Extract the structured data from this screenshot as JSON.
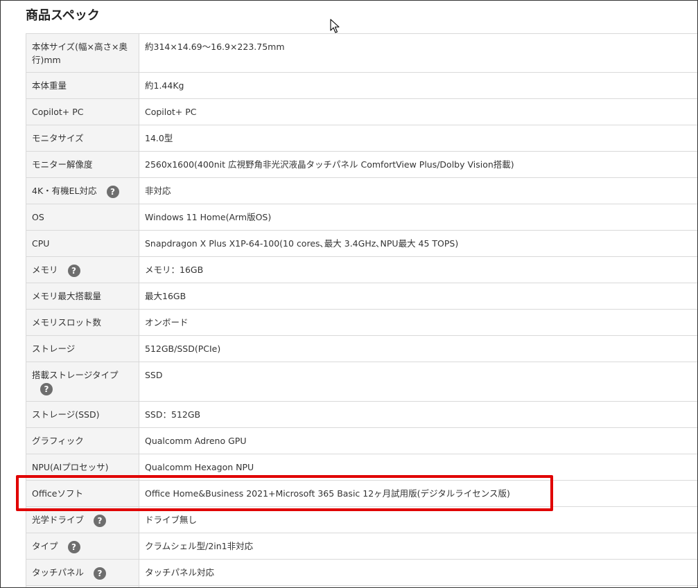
{
  "page": {
    "title": "商品スペック",
    "help_glyph": "?"
  },
  "colors": {
    "highlight": "#e00000",
    "label_bg": "#f4f4f4",
    "border": "#d9d9d9",
    "help_icon": "#6e6e6e"
  },
  "specs": [
    {
      "label": "本体サイズ(幅×高さ×奥行)mm",
      "value": "約314×14.69～16.9×223.75mm"
    },
    {
      "label": "本体重量",
      "value": "約1.44Kg"
    },
    {
      "label": "Copilot+ PC",
      "value": "Copilot+ PC"
    },
    {
      "label": "モニタサイズ",
      "value": "14.0型"
    },
    {
      "label": "モニター解像度",
      "value": "2560x1600(400nit 広視野角非光沢液晶タッチパネル ComfortView Plus/Dolby Vision搭載)"
    },
    {
      "label": "4K・有機EL対応",
      "value": "非対応"
    },
    {
      "label": "OS",
      "value": "Windows 11 Home(Arm版OS)"
    },
    {
      "label": "CPU",
      "value": "Snapdragon X Plus X1P-64-100(10 cores､最大 3.4GHz､NPU最大 45 TOPS)"
    },
    {
      "label": "メモリ",
      "value": "メモリ：16GB"
    },
    {
      "label": "メモリ最大搭載量",
      "value": "最大16GB"
    },
    {
      "label": "メモリスロット数",
      "value": "オンボード"
    },
    {
      "label": "ストレージ",
      "value": "512GB/SSD(PCIe)"
    },
    {
      "label": "搭載ストレージタイプ",
      "value": "SSD"
    },
    {
      "label": "ストレージ(SSD)",
      "value": "SSD：512GB"
    },
    {
      "label": "グラフィック",
      "value": "Qualcomm Adreno GPU"
    },
    {
      "label": "NPU(AIプロセッサ)",
      "value": "Qualcomm Hexagon NPU"
    },
    {
      "label": "Officeソフト",
      "value": "Office Home&Business 2021+Microsoft 365 Basic 12ヶ月試用版(デジタルライセンス版)"
    },
    {
      "label": "光学ドライブ",
      "value": "ドライブ無し"
    },
    {
      "label": "タイプ",
      "value": "クラムシェル型/2in1非対応"
    },
    {
      "label": "タッチパネル",
      "value": "タッチパネル対応"
    }
  ]
}
